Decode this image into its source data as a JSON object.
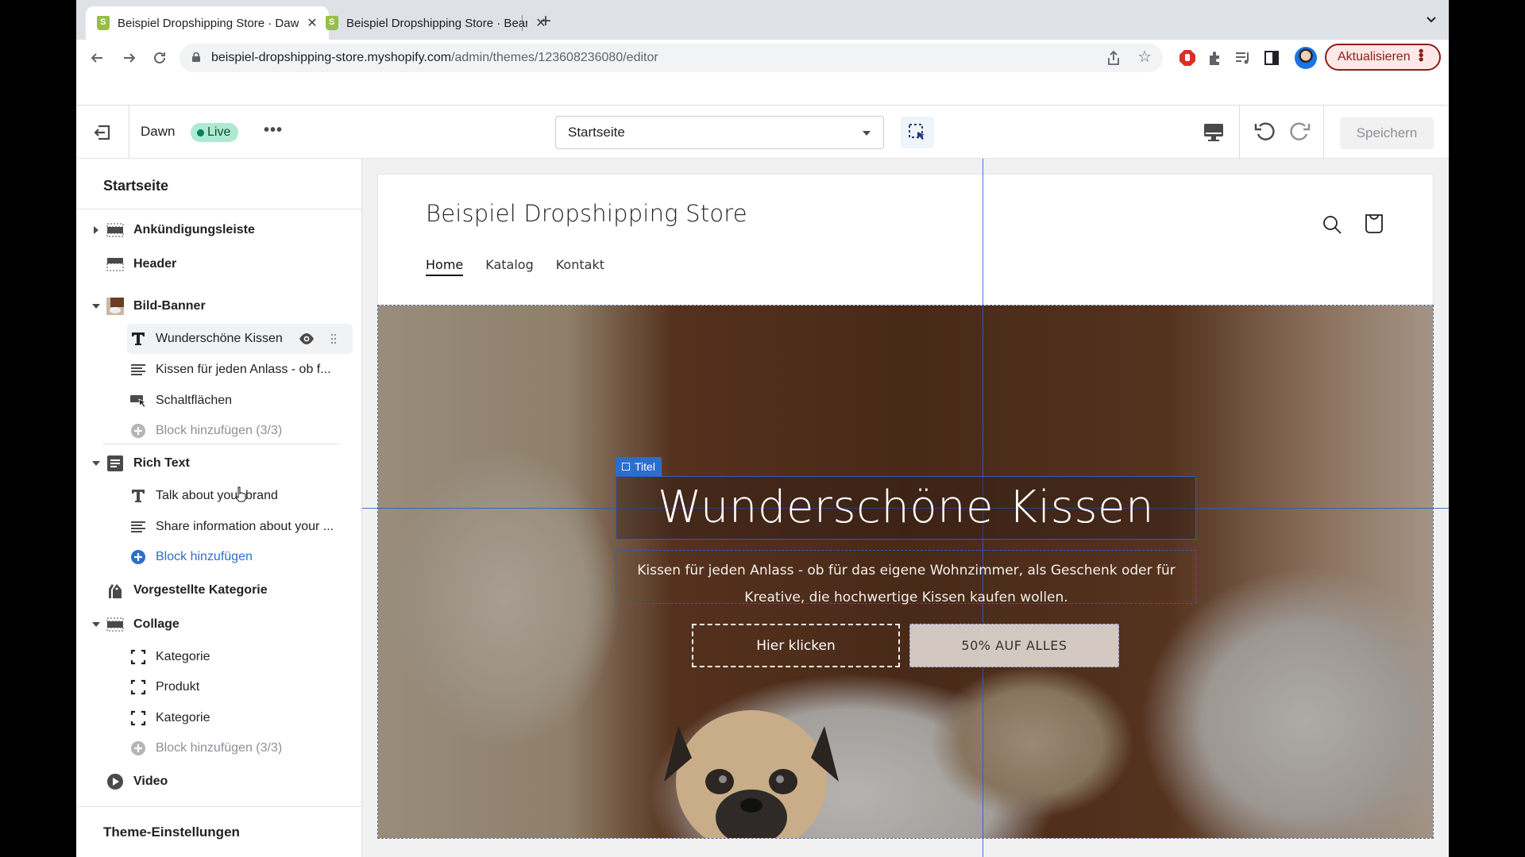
{
  "browser": {
    "tabs": [
      {
        "title": "Beispiel Dropshipping Store · Dawn",
        "active": true
      },
      {
        "title": "Beispiel Dropshipping Store · Bearbeiten",
        "active": false
      }
    ],
    "url_host": "beispiel-dropshipping-store.myshopify.com",
    "url_path": "/admin/themes/123608236080/editor",
    "update_button": "Aktualisieren",
    "icons": [
      "back-icon",
      "forward-icon",
      "reload-icon",
      "lock-icon",
      "share-icon",
      "star-icon",
      "adblock-icon",
      "extensions-icon",
      "media-icon",
      "sidepanel-icon",
      "profile-avatar"
    ]
  },
  "toolbar": {
    "theme_name": "Dawn",
    "live_badge": "Live",
    "more": "•••",
    "page_select": "Startseite",
    "save_label": "Speichern"
  },
  "sidebar": {
    "title": "Startseite",
    "items": [
      {
        "type": "section",
        "label": "Ankündigungsleiste",
        "icon": "announcement-bar-icon",
        "chevron": "right"
      },
      {
        "type": "section",
        "label": "Header",
        "icon": "header-icon",
        "chevron": null
      },
      {
        "type": "section",
        "label": "Bild-Banner",
        "icon": "image-banner-thumbnail",
        "chevron": "down"
      },
      {
        "type": "block",
        "label": "Wunderschöne Kissen",
        "icon": "text-heading-icon",
        "selected": true
      },
      {
        "type": "block",
        "label": "Kissen für jeden Anlass - ob f...",
        "icon": "paragraph-icon"
      },
      {
        "type": "block",
        "label": "Schaltflächen",
        "icon": "buttons-icon"
      },
      {
        "type": "add",
        "label": "Block hinzufügen (3/3)",
        "active": false
      },
      {
        "type": "section",
        "label": "Rich Text",
        "icon": "rich-text-icon",
        "chevron": "down"
      },
      {
        "type": "block",
        "label": "Talk about your brand",
        "icon": "text-heading-icon"
      },
      {
        "type": "block",
        "label": "Share information about your ...",
        "icon": "paragraph-icon"
      },
      {
        "type": "add",
        "label": "Block hinzufügen",
        "active": true
      },
      {
        "type": "section",
        "label": "Vorgestellte Kategorie",
        "icon": "collection-tag-icon",
        "chevron": null
      },
      {
        "type": "section",
        "label": "Collage",
        "icon": "collage-icon",
        "chevron": "down"
      },
      {
        "type": "block",
        "label": "Kategorie",
        "icon": "frame-icon"
      },
      {
        "type": "block",
        "label": "Produkt",
        "icon": "frame-icon"
      },
      {
        "type": "block",
        "label": "Kategorie",
        "icon": "frame-icon"
      },
      {
        "type": "add",
        "label": "Block hinzufügen (3/3)",
        "active": false
      },
      {
        "type": "section",
        "label": "Video",
        "icon": "video-play-icon",
        "chevron": null
      }
    ],
    "footer": "Theme-Einstellungen"
  },
  "preview": {
    "store_name": "Beispiel Dropshipping Store",
    "nav": [
      "Home",
      "Katalog",
      "Kontakt"
    ],
    "nav_active": "Home",
    "selection_label": "Titel",
    "hero_title": "Wunderschöne Kissen",
    "hero_text": "Kissen für jeden Anlass - ob für das eigene Wohnzimmer, als Geschenk oder für Kreative, die hochwertige Kissen kaufen wollen.",
    "button_primary": "Hier klicken",
    "button_secondary": "50% AUF ALLES"
  },
  "colors": {
    "accent_blue": "#2c6ecb",
    "live_badge_bg": "#aee9d1",
    "live_dot": "#007f5f",
    "update_button": "#8c1d18"
  }
}
